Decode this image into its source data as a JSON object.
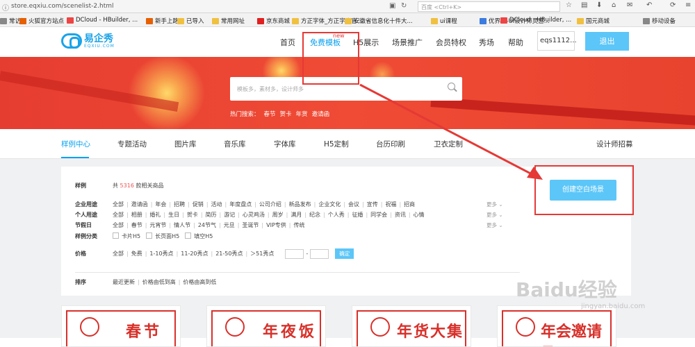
{
  "browser": {
    "url": "store.eqxiu.com/scenelist-2.html",
    "search_placeholder": "百度 <Ctrl+K>",
    "bookmarks": [
      "常访问",
      "火狐官方站点",
      "DCloud - HBuilder, ...",
      "新手上路",
      "已导入",
      "常用网址",
      "京东商城",
      "方正字体_方正字库官...",
      "安徽省信息化十件大...",
      "ui课程",
      "优界网-UI设计师灵感...",
      "DCloud - HBuilder, ...",
      "国元商城",
      "移动设备"
    ]
  },
  "header": {
    "logo_cn": "易企秀",
    "logo_en": "EQXIU.COM",
    "nav": [
      "首页",
      "免费模板",
      "H5展示",
      "场景推广",
      "会员特权",
      "秀场",
      "帮助"
    ],
    "new_tag": "new",
    "user": "eqs1112...",
    "logout": "退出"
  },
  "banner": {
    "search_placeholder": "模板多，素材多，设计师多",
    "hot_label": "热门搜索：",
    "hot_items": [
      "春节",
      "贺卡",
      "年货",
      "邀请函"
    ]
  },
  "tabs": [
    "样例中心",
    "专题活动",
    "图片库",
    "音乐库",
    "字体库",
    "H5定制",
    "台历印刷",
    "卫衣定制"
  ],
  "tab_right": "设计师招募",
  "filter": {
    "sample_label": "样例",
    "count_prefix": "共",
    "count": "5316",
    "count_suffix": "款相关商品",
    "rows": [
      {
        "label": "企业用途",
        "options": [
          "全部",
          "邀请函",
          "年会",
          "招聘",
          "促销",
          "活动",
          "年度盘点",
          "公司介绍",
          "新品发布",
          "企业文化",
          "会议",
          "宣传",
          "祝福",
          "招商"
        ]
      },
      {
        "label": "个人用途",
        "options": [
          "全部",
          "相册",
          "婚礼",
          "生日",
          "贺卡",
          "简历",
          "游记",
          "心灵鸡汤",
          "周岁",
          "满月",
          "纪念",
          "个人秀",
          "征婚",
          "同学会",
          "资讯",
          "心情"
        ]
      },
      {
        "label": "节假日",
        "options": [
          "全部",
          "春节",
          "元宵节",
          "情人节",
          "24节气",
          "元旦",
          "圣诞节",
          "VIP专供",
          "传统"
        ]
      }
    ],
    "more": "更多",
    "category_label": "样例分类",
    "category_options": [
      "卡片H5",
      "长页面H5",
      "填空H5"
    ],
    "price_label": "价格",
    "price_options": [
      "全部",
      "免费",
      "1-10秀点",
      "11-20秀点",
      "21-50秀点",
      "＞51秀点"
    ],
    "price_dash": "-",
    "confirm": "确定",
    "sort_label": "排序",
    "sort_options": [
      "最近更新",
      "价格由低到高",
      "价格由高到低"
    ]
  },
  "create_button": "创建空白场景",
  "cards": [
    "春节",
    "年夜饭",
    "年货大集",
    "年会邀请函"
  ],
  "watermark": "Baidu经验",
  "watermark_url": "jingyan.baidu.com"
}
